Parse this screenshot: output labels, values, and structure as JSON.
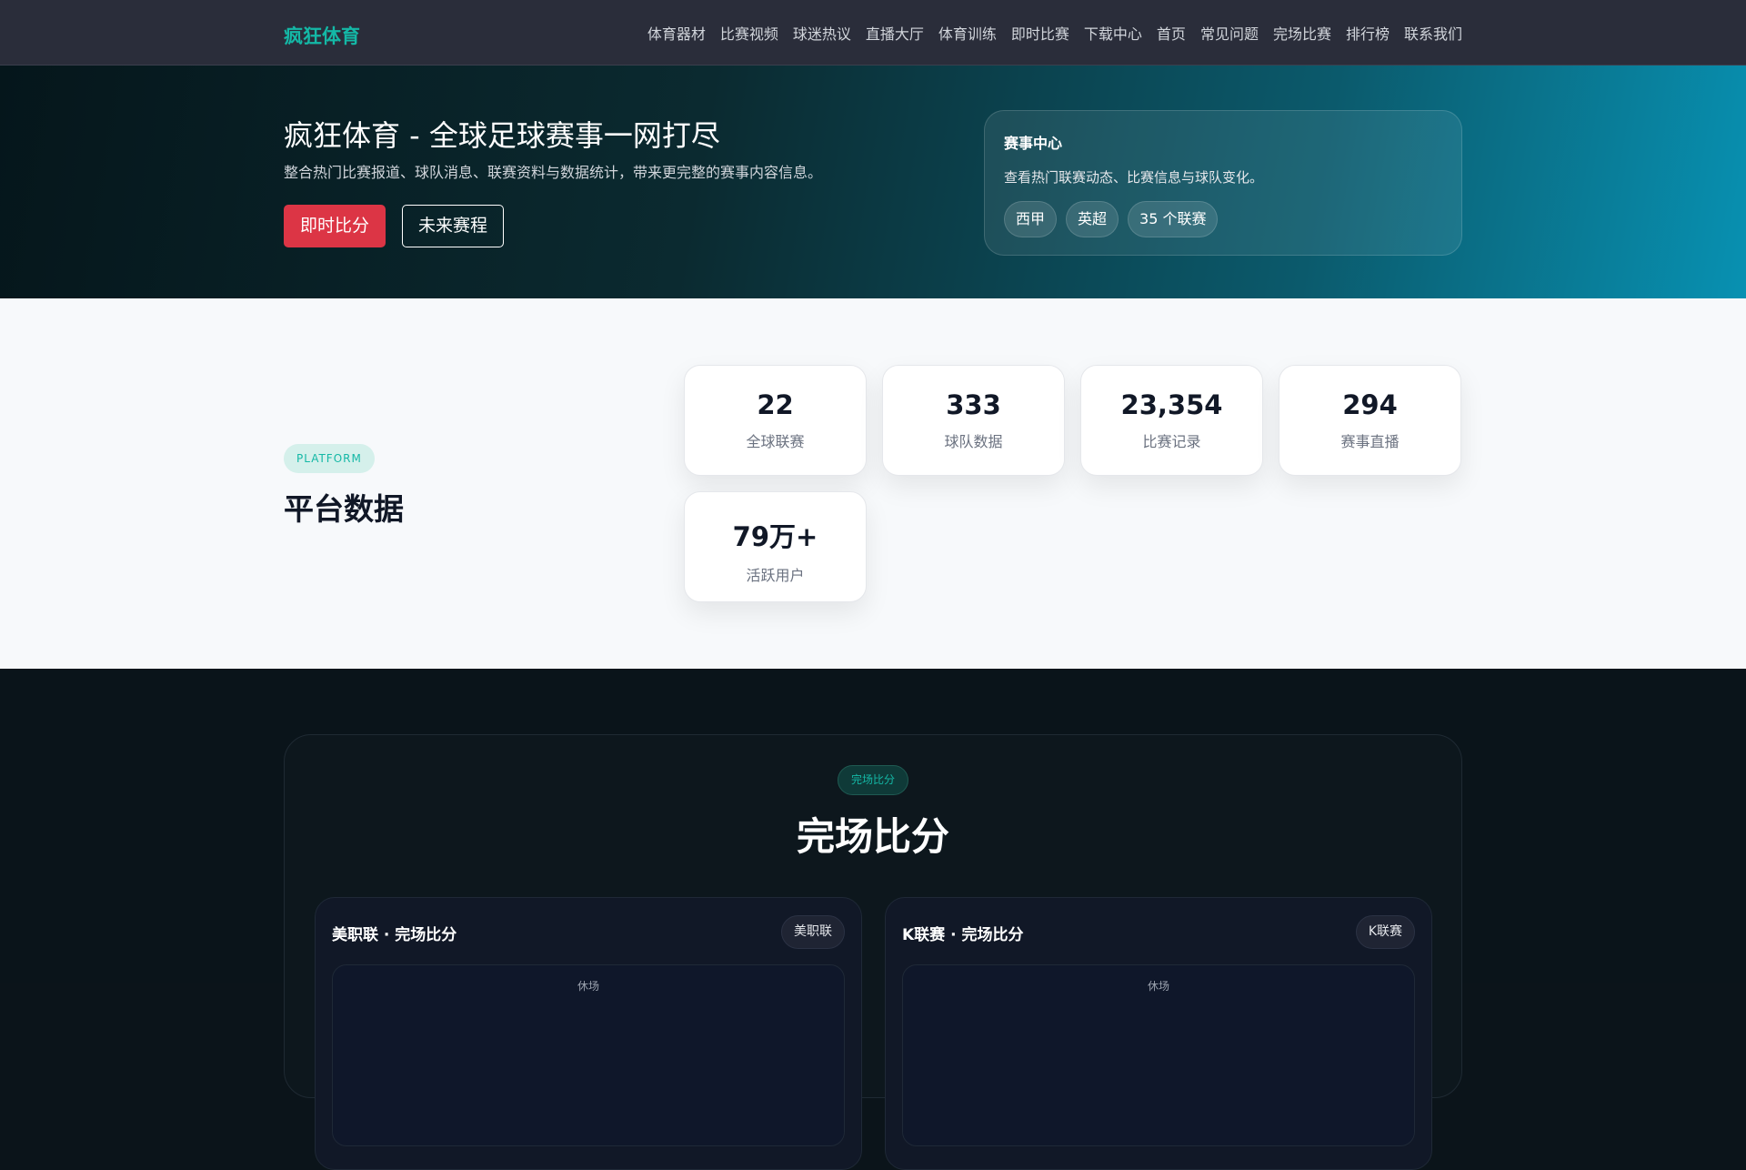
{
  "nav": {
    "logo": "疯狂体育",
    "items": [
      "体育器材",
      "比赛视频",
      "球迷热议",
      "直播大厅",
      "体育训练",
      "即时比赛",
      "下载中心",
      "首页",
      "常见问题",
      "完场比赛",
      "排行榜",
      "联系我们"
    ]
  },
  "hero": {
    "title": "疯狂体育 - 全球足球赛事一网打尽",
    "subtitle": "整合热门比赛报道、球队消息、联赛资料与数据统计，带来更完整的赛事内容信息。",
    "btn_primary": "即时比分",
    "btn_secondary": "未来赛程",
    "card": {
      "title": "赛事中心",
      "text": "查看热门联赛动态、比赛信息与球队变化。",
      "chips": [
        "西甲",
        "英超",
        "35 个联赛"
      ]
    }
  },
  "platform": {
    "badge": "PLATFORM",
    "title": "平台数据",
    "stats": [
      {
        "value": "22",
        "label": "全球联赛"
      },
      {
        "value": "333",
        "label": "球队数据"
      },
      {
        "value": "23,354",
        "label": "比赛记录"
      },
      {
        "value": "294",
        "label": "赛事直播"
      },
      {
        "value": "79万+",
        "label": "活跃用户"
      }
    ]
  },
  "results": {
    "badge": "完场比分",
    "title": "完场比分",
    "cards": [
      {
        "title": "美职联 · 完场比分",
        "tag": "美职联",
        "inner": "休场"
      },
      {
        "title": "K联赛 · 完场比分",
        "tag": "K联赛",
        "inner": "休场"
      }
    ]
  }
}
